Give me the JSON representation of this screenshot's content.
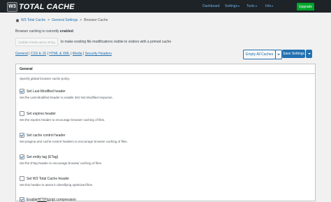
{
  "app": {
    "logo_badge": "W3",
    "logo_text": "TOTAL CACHE"
  },
  "topnav": {
    "items": [
      {
        "label": "Dashboard",
        "has_caret": false
      },
      {
        "label": "Settings",
        "has_caret": true
      },
      {
        "label": "Tools",
        "has_caret": true
      },
      {
        "label": "Info",
        "has_caret": true
      }
    ],
    "upgrade_label": "Upgrade"
  },
  "breadcrumb": {
    "items": [
      "W3 Total Cache",
      "General Settings",
      "Browser Cache"
    ],
    "separator": ">"
  },
  "status": {
    "prefix": "Browser caching is currently ",
    "state": "enabled",
    "suffix": "."
  },
  "query_string": {
    "button_label": "Update media query string",
    "description": "to make existing file modifications visible to visitors with a primed cache"
  },
  "jumplinks": {
    "items": [
      "General",
      "CSS & JS",
      "HTML & XML",
      "Media",
      "Security Headers"
    ],
    "separator": " | "
  },
  "actions": {
    "empty_caches_label": "Empty All Caches",
    "save_settings_label": "Save Settings"
  },
  "panel": {
    "title": "General",
    "description": "Specify global browser cache policy.",
    "options": [
      {
        "label": "Set Last-Modified header",
        "checked": true,
        "description": "Set the Last-Modified header to enable 304 Not Modified response."
      },
      {
        "label": "Set expires header",
        "checked": false,
        "description": "Set the expires header to encourage browser caching of files."
      },
      {
        "label": "Set cache control header",
        "checked": true,
        "description": "Set pragma and cache-control headers to encourage browser caching of files."
      },
      {
        "label": "Set entity tag (ETag)",
        "checked": true,
        "description": "Set the ETag header to encourage browser caching of files."
      },
      {
        "label": "Set W3 Total Cache header",
        "checked": false,
        "description": "Set this header to assist in identifying optimized files."
      },
      {
        "label_prefix": "Enable ",
        "label_link": "HTTP",
        "label_suffix": " (gzip) compression",
        "checked": true,
        "description": ""
      }
    ]
  },
  "colors": {
    "topbar": "#1d2327",
    "accent": "#2271b1",
    "upgrade": "#00a32a",
    "nav_link": "#72aee6"
  }
}
